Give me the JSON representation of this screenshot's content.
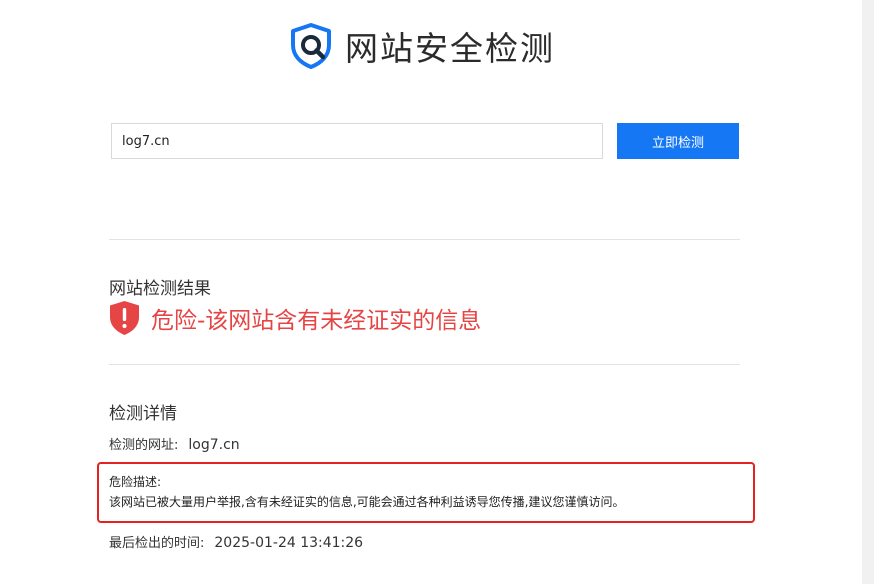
{
  "header": {
    "title": "网站安全检测",
    "logo_icon": "shield-search-icon"
  },
  "search": {
    "value": "log7.cn",
    "button_label": "立即检测"
  },
  "result": {
    "section_title": "网站检测结果",
    "status_icon": "danger-shield-icon",
    "status_text": "危险-该网站含有未经证实的信息",
    "status_color": "#e64545"
  },
  "details": {
    "section_title": "检测详情",
    "url_label": "检测的网址:",
    "url_value": "log7.cn",
    "description_label": "危险描述:",
    "description_text": "该网站已被大量用户举报,含有未经证实的信息,可能会通过各种利益诱导您传播,建议您谨慎访问。",
    "time_label": "最后检出的时间:",
    "time_value": "2025-01-24 13:41:26"
  },
  "colors": {
    "accent": "#1677f5",
    "danger": "#e64545",
    "highlight_border": "#e52222"
  }
}
